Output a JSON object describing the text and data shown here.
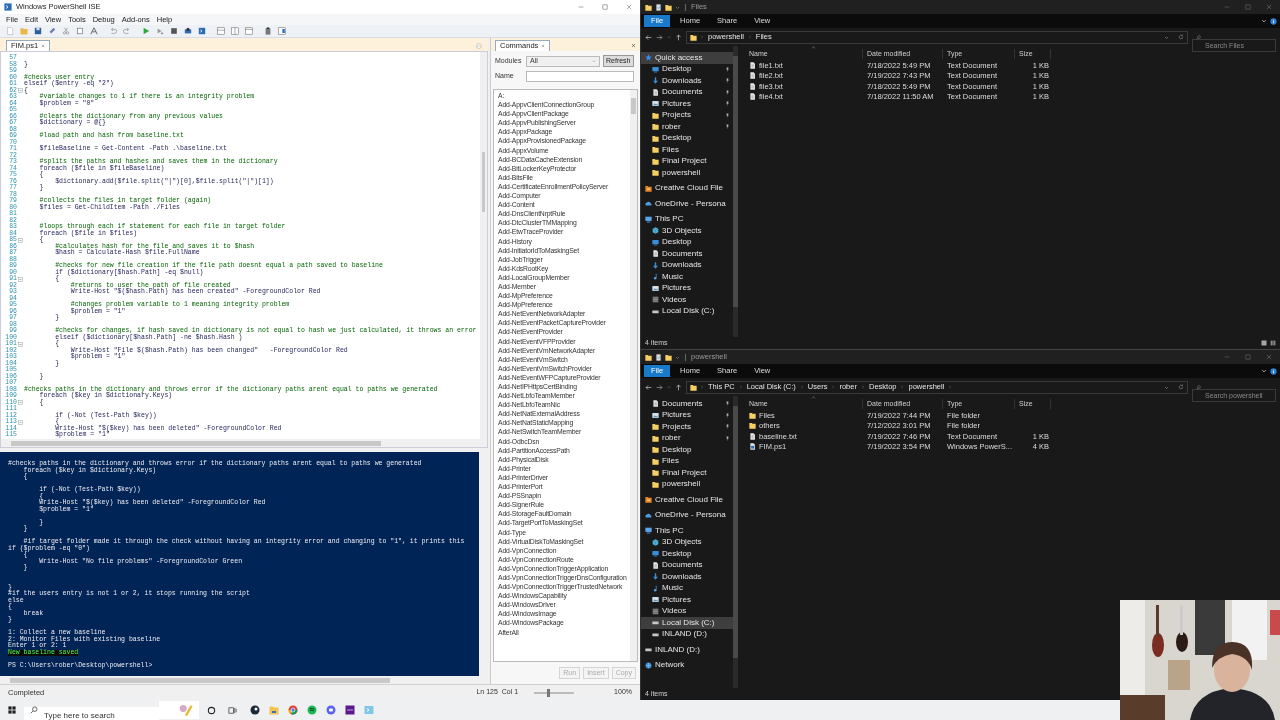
{
  "ise": {
    "title": "Windows PowerShell ISE",
    "menu": [
      "File",
      "Edit",
      "View",
      "Tools",
      "Debug",
      "Add-ons",
      "Help"
    ],
    "tabs": [
      {
        "label": "FIM.ps1",
        "selected": true
      }
    ],
    "editor_lines": [
      {
        "num": "57"
      },
      {
        "num": "58",
        "text": "}",
        "kind": "code"
      },
      {
        "num": "59"
      },
      {
        "num": "60",
        "text": "#checks user entry",
        "kind": "comment"
      },
      {
        "num": "61",
        "text": "elseif ($entry -eq \"2\")",
        "kind": "code"
      },
      {
        "num": "62",
        "text": "{",
        "kind": "code",
        "fold": true
      },
      {
        "num": "63",
        "text": "    #variable changes to 1 if there is an integrity problem",
        "kind": "comment"
      },
      {
        "num": "64",
        "text": "    $problem = \"0\"",
        "kind": "code"
      },
      {
        "num": "65"
      },
      {
        "num": "66",
        "text": "    #clears the dictionary from any previous values",
        "kind": "comment"
      },
      {
        "num": "67",
        "text": "    $dictionary = @{}",
        "kind": "code"
      },
      {
        "num": "68"
      },
      {
        "num": "69",
        "text": "    #load path and hash from baseline.txt",
        "kind": "comment"
      },
      {
        "num": "70"
      },
      {
        "num": "71",
        "text": "    $fileBaseline = Get-Content -Path .\\baseline.txt",
        "kind": "code"
      },
      {
        "num": "72"
      },
      {
        "num": "73",
        "text": "    #splits the paths and hashes and saves them in the dictionary",
        "kind": "comment"
      },
      {
        "num": "74",
        "text": "    foreach ($file in $fileBaseline)",
        "kind": "code"
      },
      {
        "num": "75",
        "text": "    {",
        "kind": "code"
      },
      {
        "num": "76",
        "text": "        $dictionary.add($file.split(\"|\")[0],$file.split(\"|\")[1])",
        "kind": "code"
      },
      {
        "num": "77",
        "text": "    }",
        "kind": "code"
      },
      {
        "num": "78"
      },
      {
        "num": "79",
        "text": "    #collects the files in target folder (again)",
        "kind": "comment"
      },
      {
        "num": "80",
        "text": "    $files = Get-ChildItem -Path ./Files",
        "kind": "code"
      },
      {
        "num": "81"
      },
      {
        "num": "82"
      },
      {
        "num": "83",
        "text": "    #loops through each if statement for each file in target folder",
        "kind": "comment"
      },
      {
        "num": "84",
        "text": "    foreach ($file in $files)",
        "kind": "code"
      },
      {
        "num": "85",
        "text": "    {",
        "kind": "code",
        "fold": true
      },
      {
        "num": "86",
        "text": "        #calculates hash for the file and saves it to $hash",
        "kind": "comment"
      },
      {
        "num": "87",
        "text": "        $hash = Calculate-Hash $file.FullName",
        "kind": "code"
      },
      {
        "num": "88"
      },
      {
        "num": "89",
        "text": "        #checks for new file creation if the file path doesnt equal a path saved to baseline",
        "kind": "comment"
      },
      {
        "num": "90",
        "text": "        if ($dictionary[$hash.Path] -eq $null)",
        "kind": "code"
      },
      {
        "num": "91",
        "text": "        {",
        "kind": "code",
        "fold": true
      },
      {
        "num": "92",
        "text": "            #returns to user the path of file created",
        "kind": "comment"
      },
      {
        "num": "93",
        "text": "            Write-Host \"$($hash.Path) has been created\" -ForegroundColor Red",
        "kind": "code"
      },
      {
        "num": "94"
      },
      {
        "num": "95",
        "text": "            #changes problem variable to 1 meaning integrity problem",
        "kind": "comment"
      },
      {
        "num": "96",
        "text": "            $problem = \"1\"",
        "kind": "code"
      },
      {
        "num": "97",
        "text": "        }",
        "kind": "code"
      },
      {
        "num": "98"
      },
      {
        "num": "99",
        "text": "        #checks for changes, if hash saved in dictionary is not equal to hash we just calculated, it throws an error",
        "kind": "comment"
      },
      {
        "num": "100",
        "text": "        elseif ($dictionary[$hash.Path] -ne $hash.Hash )",
        "kind": "code"
      },
      {
        "num": "101",
        "text": "        {",
        "kind": "code",
        "fold": true
      },
      {
        "num": "102",
        "text": "            Write-Host \"File $($hash.Path) has been changed\"   -ForegroundColor Red",
        "kind": "code"
      },
      {
        "num": "103",
        "text": "            $problem = \"1\"",
        "kind": "code"
      },
      {
        "num": "104",
        "text": "        }",
        "kind": "code"
      },
      {
        "num": "105"
      },
      {
        "num": "106",
        "text": "    }",
        "kind": "code"
      },
      {
        "num": "107"
      },
      {
        "num": "108",
        "text": "#checks paths in the dictionary and throws error if the dictionary paths arent equal to paths we generated",
        "kind": "comment"
      },
      {
        "num": "109",
        "text": "    foreach ($key in $dictionary.Keys)",
        "kind": "code"
      },
      {
        "num": "110",
        "text": "    {",
        "kind": "code",
        "fold": true
      },
      {
        "num": "111"
      },
      {
        "num": "112",
        "text": "        if (-Not (Test-Path $key))",
        "kind": "code"
      },
      {
        "num": "113",
        "text": "        {",
        "kind": "code",
        "fold": true
      },
      {
        "num": "114",
        "text": "        Write-Host \"$($key) has been deleted\" -ForegroundColor Red",
        "kind": "code"
      },
      {
        "num": "115",
        "text": "        $problem = \"1\"",
        "kind": "code"
      }
    ],
    "console_lines": [
      {
        "kind": "output",
        "text": "#checks paths in the dictionary and throws error if the dictionary paths arent equal to paths we generated"
      },
      {
        "kind": "output",
        "text": "    foreach ($key in $dictionary.Keys)"
      },
      {
        "kind": "output",
        "text": "    {"
      },
      {
        "kind": "blank"
      },
      {
        "kind": "output",
        "text": "        if (-Not (Test-Path $key))"
      },
      {
        "kind": "output",
        "text": "        {"
      },
      {
        "kind": "output",
        "text": "        Write-Host \"$($key) has been deleted\" -ForegroundColor Red"
      },
      {
        "kind": "output",
        "text": "        $problem = \"1\""
      },
      {
        "kind": "blank"
      },
      {
        "kind": "output",
        "text": "        }"
      },
      {
        "kind": "output",
        "text": "    }"
      },
      {
        "kind": "blank"
      },
      {
        "kind": "output",
        "text": "    #if target folder made it through the check without having an integrity error and changing to \"1\", it prints this"
      },
      {
        "kind": "output",
        "text": "if ($problem -eq \"0\")"
      },
      {
        "kind": "output",
        "text": "    {"
      },
      {
        "kind": "output",
        "text": "        Write-Host \"No file problems\" -ForegroundColor Green"
      },
      {
        "kind": "output",
        "text": "    }"
      },
      {
        "kind": "blank"
      },
      {
        "kind": "blank"
      },
      {
        "kind": "output",
        "text": "}"
      },
      {
        "kind": "output",
        "text": "#if the users entry is not 1 or 2, it stops running the script"
      },
      {
        "kind": "output",
        "text": "else"
      },
      {
        "kind": "output",
        "text": "{"
      },
      {
        "kind": "output",
        "text": "    break"
      },
      {
        "kind": "output",
        "text": "}"
      },
      {
        "kind": "blank"
      },
      {
        "kind": "output",
        "text": "1: Collect a new baseline"
      },
      {
        "kind": "output",
        "text": "2: Monitor Files with existing baseline"
      },
      {
        "kind": "output",
        "text": "Enter 1 or 2: 1"
      },
      {
        "kind": "success",
        "text": "New baseline saved"
      },
      {
        "kind": "blank"
      },
      {
        "kind": "output",
        "text": "PS C:\\Users\\rober\\Desktop\\powershell>"
      }
    ],
    "status": "Completed",
    "position": "Ln 125  Col 1",
    "zoom_slider": {
      "level": 0.35
    },
    "zoom": "100%"
  },
  "commands": {
    "title": "Commands",
    "modules_label": "Modules",
    "modules_value": "All",
    "refresh": "Refresh",
    "name_label": "Name",
    "items": [
      "A:",
      "Add-AppvClientConnectionGroup",
      "Add-AppvClientPackage",
      "Add-AppvPublishingServer",
      "Add-AppxPackage",
      "Add-AppxProvisionedPackage",
      "Add-AppxVolume",
      "Add-BCDataCacheExtension",
      "Add-BitLockerKeyProtector",
      "Add-BitsFile",
      "Add-CertificateEnrollmentPolicyServer",
      "Add-Computer",
      "Add-Content",
      "Add-DnsClientNrptRule",
      "Add-DtcClusterTMMapping",
      "Add-EtwTraceProvider",
      "Add-History",
      "Add-InitiatorIdToMaskingSet",
      "Add-JobTrigger",
      "Add-KdsRootKey",
      "Add-LocalGroupMember",
      "Add-Member",
      "Add-MpPreference",
      "Add-MpPreference",
      "Add-NetEventNetworkAdapter",
      "Add-NetEventPacketCaptureProvider",
      "Add-NetEventProvider",
      "Add-NetEventVFPProvider",
      "Add-NetEventVmNetworkAdapter",
      "Add-NetEventVmSwitch",
      "Add-NetEventVmSwitchProvider",
      "Add-NetEventWFPCaptureProvider",
      "Add-NetIPHttpsCertBinding",
      "Add-NetLbfoTeamMember",
      "Add-NetLbfoTeamNic",
      "Add-NetNatExternalAddress",
      "Add-NetNatStaticMapping",
      "Add-NetSwitchTeamMember",
      "Add-OdbcDsn",
      "Add-PartitionAccessPath",
      "Add-PhysicalDisk",
      "Add-Printer",
      "Add-PrinterDriver",
      "Add-PrinterPort",
      "Add-PSSnapin",
      "Add-SignerRule",
      "Add-StorageFaultDomain",
      "Add-TargetPortToMaskingSet",
      "Add-Type",
      "Add-VirtualDiskToMaskingSet",
      "Add-VpnConnection",
      "Add-VpnConnectionRoute",
      "Add-VpnConnectionTriggerApplication",
      "Add-VpnConnectionTriggerDnsConfiguration",
      "Add-VpnConnectionTriggerTrustedNetwork",
      "Add-WindowsCapability",
      "Add-WindowsDriver",
      "Add-WindowsImage",
      "Add-WindowsPackage",
      "AfterAll"
    ],
    "buttons": [
      {
        "label": "Run",
        "disabled": true
      },
      {
        "label": "Insert",
        "disabled": true
      },
      {
        "label": "Copy",
        "disabled": true
      }
    ]
  },
  "explorers": [
    {
      "title": "Files",
      "ribbon_tabs": [
        {
          "label": "File",
          "selected": true
        },
        {
          "label": "Home",
          "selected": false
        },
        {
          "label": "Share",
          "selected": false
        },
        {
          "label": "View",
          "selected": false
        }
      ],
      "path": [
        "powershell",
        "Files"
      ],
      "search_placeholder": "Search Files",
      "nav": [
        {
          "label": "Quick access",
          "kind": "star",
          "selected": true,
          "children": [
            {
              "label": "Desktop",
              "kind": "desktop",
              "pinned": true,
              "selected": false
            },
            {
              "label": "Downloads",
              "kind": "download",
              "pinned": true,
              "selected": false
            },
            {
              "label": "Documents",
              "kind": "document",
              "pinned": true,
              "selected": false
            },
            {
              "label": "Pictures",
              "kind": "picture",
              "pinned": true,
              "selected": false
            },
            {
              "label": "Projects",
              "kind": "folder",
              "pinned": true,
              "selected": false
            },
            {
              "label": "rober",
              "kind": "folder",
              "pinned": true,
              "selected": false
            },
            {
              "label": "Desktop",
              "kind": "folder",
              "pinned": false,
              "selected": false
            },
            {
              "label": "Files",
              "kind": "folder",
              "pinned": false,
              "selected": false
            },
            {
              "label": "Final Project",
              "kind": "folder",
              "pinned": false,
              "selected": false
            },
            {
              "label": "powershell",
              "kind": "folder",
              "pinned": false,
              "selected": false
            }
          ]
        },
        {
          "label": "Creative Cloud File",
          "kind": "cloudfolder",
          "selected": false
        },
        {
          "label": "OneDrive - Persona",
          "kind": "cloud",
          "selected": false
        },
        {
          "label": "This PC",
          "kind": "pc",
          "selected": false,
          "children": [
            {
              "label": "3D Objects",
              "kind": "cube",
              "selected": false
            },
            {
              "label": "Desktop",
              "kind": "desktop",
              "selected": false
            },
            {
              "label": "Documents",
              "kind": "document",
              "selected": false
            },
            {
              "label": "Downloads",
              "kind": "download",
              "selected": false
            },
            {
              "label": "Music",
              "kind": "music",
              "selected": false
            },
            {
              "label": "Pictures",
              "kind": "picture",
              "selected": false
            },
            {
              "label": "Videos",
              "kind": "video",
              "selected": false
            },
            {
              "label": "Local Disk (C:)",
              "kind": "disk",
              "selected": false
            }
          ]
        }
      ],
      "columns": [
        "Name",
        "Date modified",
        "Type",
        "Size"
      ],
      "files": [
        {
          "name": "file1.txt",
          "kind": "text",
          "date": "7/18/2022 5:49 PM",
          "type": "Text Document",
          "size": "1 KB"
        },
        {
          "name": "file2.txt",
          "kind": "text",
          "date": "7/19/2022 7:43 PM",
          "type": "Text Document",
          "size": "1 KB"
        },
        {
          "name": "file3.txt",
          "kind": "text",
          "date": "7/18/2022 5:49 PM",
          "type": "Text Document",
          "size": "1 KB"
        },
        {
          "name": "file4.txt",
          "kind": "text",
          "date": "7/18/2022 11:50 AM",
          "type": "Text Document",
          "size": "1 KB"
        }
      ],
      "status": "4 items"
    },
    {
      "title": "powershell",
      "ribbon_tabs": [
        {
          "label": "File",
          "selected": true
        },
        {
          "label": "Home",
          "selected": false
        },
        {
          "label": "Share",
          "selected": false
        },
        {
          "label": "View",
          "selected": false
        }
      ],
      "path": [
        "This PC",
        "Local Disk (C:)",
        "Users",
        "rober",
        "Desktop",
        "powershell"
      ],
      "search_placeholder": "Search powershell",
      "nav": [
        {
          "children": [
            {
              "label": "Documents",
              "kind": "document",
              "pinned": true,
              "selected": false
            },
            {
              "label": "Pictures",
              "kind": "picture",
              "pinned": true,
              "selected": false
            },
            {
              "label": "Projects",
              "kind": "folder",
              "pinned": true,
              "selected": false
            },
            {
              "label": "rober",
              "kind": "folder",
              "pinned": true,
              "selected": false
            },
            {
              "label": "Desktop",
              "kind": "folder",
              "pinned": false,
              "selected": false
            },
            {
              "label": "Files",
              "kind": "folder",
              "pinned": false,
              "selected": false
            },
            {
              "label": "Final Project",
              "kind": "folder",
              "pinned": false,
              "selected": false
            },
            {
              "label": "powershell",
              "kind": "folder",
              "pinned": false,
              "selected": false
            }
          ]
        },
        {
          "label": "Creative Cloud File",
          "kind": "cloudfolder",
          "selected": false
        },
        {
          "label": "OneDrive - Persona",
          "kind": "cloud",
          "selected": false
        },
        {
          "label": "This PC",
          "kind": "pc",
          "selected": false,
          "children": [
            {
              "label": "3D Objects",
              "kind": "cube",
              "selected": false
            },
            {
              "label": "Desktop",
              "kind": "desktop",
              "selected": false
            },
            {
              "label": "Documents",
              "kind": "document",
              "selected": false
            },
            {
              "label": "Downloads",
              "kind": "download",
              "selected": false
            },
            {
              "label": "Music",
              "kind": "music",
              "selected": false
            },
            {
              "label": "Pictures",
              "kind": "picture",
              "selected": false
            },
            {
              "label": "Videos",
              "kind": "video",
              "selected": false
            },
            {
              "label": "Local Disk (C:)",
              "kind": "disk",
              "selected": true
            },
            {
              "label": "INLAND (D:)",
              "kind": "disk",
              "selected": false
            }
          ]
        },
        {
          "label": "INLAND (D:)",
          "kind": "disk",
          "selected": false
        },
        {
          "label": "Network",
          "kind": "network",
          "selected": false
        }
      ],
      "columns": [
        "Name",
        "Date modified",
        "Type",
        "Size"
      ],
      "files": [
        {
          "name": "Files",
          "kind": "folder",
          "date": "7/19/2022 7:44 PM",
          "type": "File folder"
        },
        {
          "name": "others",
          "kind": "folder",
          "date": "7/12/2022 3:01 PM",
          "type": "File folder"
        },
        {
          "name": "baseline.txt",
          "kind": "text",
          "date": "7/19/2022 7:46 PM",
          "type": "Text Document",
          "size": "1 KB"
        },
        {
          "name": "FIM.ps1",
          "kind": "script",
          "date": "7/19/2022 3:54 PM",
          "type": "Windows PowerS...",
          "size": "4 KB"
        }
      ],
      "status": "4 items"
    }
  ],
  "taskbar": {
    "search_placeholder": "Type here to search"
  }
}
